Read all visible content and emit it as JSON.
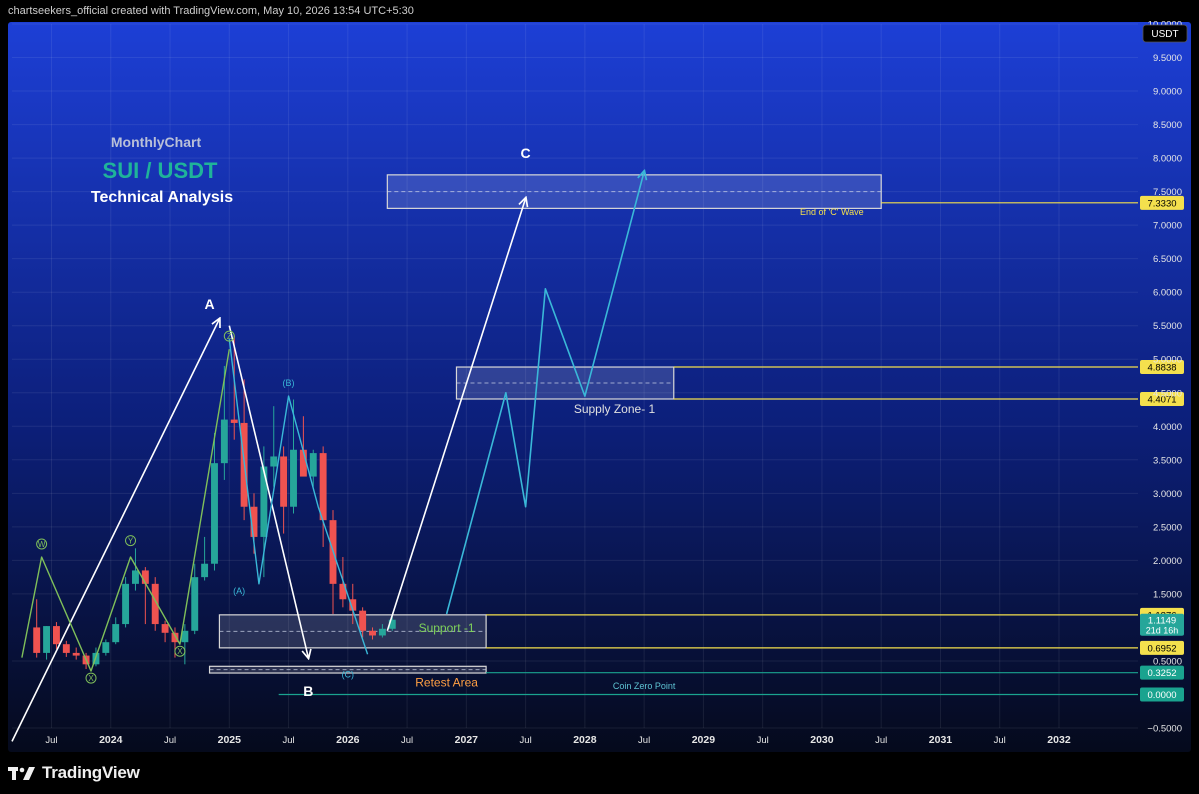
{
  "attribution": "chartseekers_official created with TradingView.com, May 10, 2026 13:54 UTC+5:30",
  "brand": {
    "name": "TradingView"
  },
  "colors": {
    "bg_top": "#1d3fd6",
    "bg_bottom": "#050a1c",
    "up": "#26a69a",
    "down": "#ef5350",
    "wave_white": "#ffffff",
    "wave_cyan": "#3ab8d8",
    "wave_green": "#7fbf5a",
    "level_yellow": "#f4e04d",
    "level_teal": "#1aa38f",
    "retest": "#ff9f43",
    "support_text": "#7fd35a"
  },
  "headings": {
    "monthly": "MonthlyChart",
    "pair": "SUI / USDT",
    "analysis": "Technical Analysis"
  },
  "chart_data": {
    "type": "candlestick",
    "currency_label": "USDT",
    "ylim": [
      -0.5,
      10.0
    ],
    "xlim": [
      "2023-03",
      "2032-09"
    ],
    "y_ticks": [
      -0.5,
      0.5,
      1.5,
      2.0,
      2.5,
      3.0,
      3.5,
      4.0,
      4.5,
      5.0,
      5.5,
      6.0,
      6.5,
      7.0,
      7.5,
      8.0,
      8.5,
      9.0,
      9.5,
      10.0
    ],
    "y_tick_labels": [
      "−0.5000",
      "0.5000",
      "1.5000",
      "2.0000",
      "2.5000",
      "3.0000",
      "3.5000",
      "4.0000",
      "4.5000",
      "5.0000",
      "5.5000",
      "6.0000",
      "6.5000",
      "7.0000",
      "7.5000",
      "8.0000",
      "8.5000",
      "9.0000",
      "9.5000",
      "10.0000"
    ],
    "x_ticks": [
      {
        "date": "2023-07",
        "label": "Jul"
      },
      {
        "date": "2024-01",
        "label": "2024"
      },
      {
        "date": "2024-07",
        "label": "Jul"
      },
      {
        "date": "2025-01",
        "label": "2025"
      },
      {
        "date": "2025-07",
        "label": "Jul"
      },
      {
        "date": "2026-01",
        "label": "2026"
      },
      {
        "date": "2026-07",
        "label": "Jul"
      },
      {
        "date": "2027-01",
        "label": "2027"
      },
      {
        "date": "2027-07",
        "label": "Jul"
      },
      {
        "date": "2028-01",
        "label": "2028"
      },
      {
        "date": "2028-07",
        "label": "Jul"
      },
      {
        "date": "2029-01",
        "label": "2029"
      },
      {
        "date": "2029-07",
        "label": "Jul"
      },
      {
        "date": "2030-01",
        "label": "2030"
      },
      {
        "date": "2030-07",
        "label": "Jul"
      },
      {
        "date": "2031-01",
        "label": "2031"
      },
      {
        "date": "2031-07",
        "label": "Jul"
      },
      {
        "date": "2032-01",
        "label": "2032"
      }
    ],
    "candles": [
      {
        "t": "2023-05",
        "o": 1.0,
        "h": 1.42,
        "l": 0.55,
        "c": 0.62
      },
      {
        "t": "2023-06",
        "o": 0.62,
        "h": 1.02,
        "l": 0.52,
        "c": 1.02
      },
      {
        "t": "2023-07",
        "o": 1.02,
        "h": 1.08,
        "l": 0.68,
        "c": 0.75
      },
      {
        "t": "2023-08",
        "o": 0.75,
        "h": 0.8,
        "l": 0.56,
        "c": 0.62
      },
      {
        "t": "2023-09",
        "o": 0.62,
        "h": 0.7,
        "l": 0.52,
        "c": 0.58
      },
      {
        "t": "2023-10",
        "o": 0.58,
        "h": 0.62,
        "l": 0.38,
        "c": 0.45
      },
      {
        "t": "2023-11",
        "o": 0.45,
        "h": 0.7,
        "l": 0.42,
        "c": 0.62
      },
      {
        "t": "2023-12",
        "o": 0.62,
        "h": 0.82,
        "l": 0.58,
        "c": 0.78
      },
      {
        "t": "2024-01",
        "o": 0.78,
        "h": 1.15,
        "l": 0.75,
        "c": 1.05
      },
      {
        "t": "2024-02",
        "o": 1.05,
        "h": 1.75,
        "l": 1.0,
        "c": 1.65
      },
      {
        "t": "2024-03",
        "o": 1.65,
        "h": 2.18,
        "l": 1.55,
        "c": 1.85
      },
      {
        "t": "2024-04",
        "o": 1.85,
        "h": 1.9,
        "l": 1.05,
        "c": 1.65
      },
      {
        "t": "2024-05",
        "o": 1.65,
        "h": 1.75,
        "l": 0.95,
        "c": 1.05
      },
      {
        "t": "2024-06",
        "o": 1.05,
        "h": 1.1,
        "l": 0.78,
        "c": 0.92
      },
      {
        "t": "2024-07",
        "o": 0.92,
        "h": 1.0,
        "l": 0.55,
        "c": 0.78
      },
      {
        "t": "2024-08",
        "o": 0.78,
        "h": 1.05,
        "l": 0.45,
        "c": 0.95
      },
      {
        "t": "2024-09",
        "o": 0.95,
        "h": 1.95,
        "l": 0.9,
        "c": 1.75
      },
      {
        "t": "2024-10",
        "o": 1.75,
        "h": 2.35,
        "l": 1.7,
        "c": 1.95
      },
      {
        "t": "2024-11",
        "o": 1.95,
        "h": 3.9,
        "l": 1.85,
        "c": 3.45
      },
      {
        "t": "2024-12",
        "o": 3.45,
        "h": 4.9,
        "l": 3.2,
        "c": 4.1
      },
      {
        "t": "2025-01",
        "o": 4.1,
        "h": 5.35,
        "l": 3.8,
        "c": 4.05
      },
      {
        "t": "2025-02",
        "o": 4.05,
        "h": 4.7,
        "l": 2.6,
        "c": 2.8
      },
      {
        "t": "2025-03",
        "o": 2.8,
        "h": 3.0,
        "l": 2.1,
        "c": 2.35
      },
      {
        "t": "2025-04",
        "o": 2.35,
        "h": 3.7,
        "l": 1.75,
        "c": 3.4
      },
      {
        "t": "2025-05",
        "o": 3.4,
        "h": 4.3,
        "l": 3.1,
        "c": 3.55
      },
      {
        "t": "2025-06",
        "o": 3.55,
        "h": 3.7,
        "l": 2.4,
        "c": 2.8
      },
      {
        "t": "2025-07",
        "o": 2.8,
        "h": 4.4,
        "l": 2.7,
        "c": 3.65
      },
      {
        "t": "2025-08",
        "o": 3.65,
        "h": 4.15,
        "l": 3.3,
        "c": 3.25
      },
      {
        "t": "2025-09",
        "o": 3.25,
        "h": 3.65,
        "l": 3.1,
        "c": 3.6
      },
      {
        "t": "2025-10",
        "o": 3.6,
        "h": 3.7,
        "l": 2.2,
        "c": 2.6
      },
      {
        "t": "2025-11",
        "o": 2.6,
        "h": 2.75,
        "l": 1.2,
        "c": 1.65
      },
      {
        "t": "2025-12",
        "o": 1.65,
        "h": 2.05,
        "l": 1.3,
        "c": 1.42
      },
      {
        "t": "2026-01",
        "o": 1.42,
        "h": 1.65,
        "l": 1.05,
        "c": 1.25
      },
      {
        "t": "2026-02",
        "o": 1.25,
        "h": 1.3,
        "l": 0.85,
        "c": 0.95
      },
      {
        "t": "2026-03",
        "o": 0.95,
        "h": 1.0,
        "l": 0.82,
        "c": 0.88
      },
      {
        "t": "2026-04",
        "o": 0.88,
        "h": 1.05,
        "l": 0.85,
        "c": 0.98
      },
      {
        "t": "2026-05",
        "o": 0.98,
        "h": 1.18,
        "l": 0.95,
        "c": 1.1149
      }
    ],
    "waves": [
      {
        "name": "white",
        "color": "#ffffff",
        "width": 1.6,
        "points": [
          [
            "2023-03",
            -0.7
          ],
          [
            "2024-12",
            5.6
          ]
        ]
      },
      {
        "name": "white",
        "color": "#ffffff",
        "width": 1.6,
        "points": [
          [
            "2025-01",
            5.5
          ],
          [
            "2025-09",
            0.55
          ]
        ]
      },
      {
        "name": "white",
        "color": "#ffffff",
        "width": 1.6,
        "points": [
          [
            "2026-05",
            0.95
          ],
          [
            "2027-07",
            7.4
          ]
        ]
      },
      {
        "name": "green",
        "color": "#7fbf5a",
        "width": 1.4,
        "points": [
          [
            "2023-04",
            0.55
          ],
          [
            "2023-06",
            2.05
          ],
          [
            "2023-11",
            0.35
          ],
          [
            "2024-03",
            2.05
          ],
          [
            "2024-08",
            0.75
          ],
          [
            "2025-01",
            5.15
          ]
        ]
      },
      {
        "name": "cyan",
        "color": "#3ab8d8",
        "width": 1.4,
        "points": [
          [
            "2025-01",
            5.3
          ],
          [
            "2025-04",
            1.65
          ],
          [
            "2025-07",
            4.45
          ],
          [
            "2025-10",
            2.8
          ],
          [
            "2026-03",
            0.6
          ]
        ]
      },
      {
        "name": "cyan",
        "color": "#3ab8d8",
        "width": 1.6,
        "points": [
          [
            "2026-11",
            1.2
          ],
          [
            "2027-05",
            4.5
          ],
          [
            "2027-07",
            2.8
          ],
          [
            "2027-09",
            6.05
          ],
          [
            "2028-01",
            4.45
          ],
          [
            "2028-07",
            7.8
          ]
        ]
      }
    ],
    "wave_labels": [
      {
        "text": "A",
        "at": [
          "2024-11",
          5.75
        ],
        "color": "#ffffff",
        "size": 14,
        "bold": true
      },
      {
        "text": "B",
        "at": [
          "2025-09",
          -0.02
        ],
        "color": "#ffffff",
        "size": 14,
        "bold": true
      },
      {
        "text": "C",
        "at": [
          "2027-07",
          8.0
        ],
        "color": "#ffffff",
        "size": 14,
        "bold": true
      },
      {
        "text": "(A)",
        "at": [
          "2025-02",
          1.5
        ],
        "color": "#3ab8d8",
        "size": 9,
        "bold": false
      },
      {
        "text": "(B)",
        "at": [
          "2025-07",
          4.6
        ],
        "color": "#3ab8d8",
        "size": 9,
        "bold": false
      },
      {
        "text": "(C)",
        "at": [
          "2026-01",
          0.25
        ],
        "color": "#3ab8d8",
        "size": 9,
        "bold": false
      },
      {
        "text": "W",
        "at": [
          "2023-06",
          2.2
        ],
        "color": "#7fbf5a",
        "size": 8,
        "circle": true
      },
      {
        "text": "X",
        "at": [
          "2023-11",
          0.2
        ],
        "color": "#7fbf5a",
        "size": 8,
        "circle": true
      },
      {
        "text": "Y",
        "at": [
          "2024-03",
          2.25
        ],
        "color": "#7fbf5a",
        "size": 8,
        "circle": true
      },
      {
        "text": "X",
        "at": [
          "2024-08",
          0.6
        ],
        "color": "#7fbf5a",
        "size": 8,
        "circle": true
      },
      {
        "text": "Z",
        "at": [
          "2025-01",
          5.3
        ],
        "color": "#7fbf5a",
        "size": 8,
        "circle": true
      }
    ],
    "zones": [
      {
        "name": "end-of-c-wave",
        "from": "2026-05",
        "to": "2030-07",
        "low": 7.25,
        "high": 7.75,
        "label": "End of 'C' Wave",
        "label_at": [
          "2030-02",
          7.15
        ],
        "label_color": "#f4e04d",
        "label_size": 9
      },
      {
        "name": "supply-zone-1",
        "from": "2026-12",
        "to": "2028-10",
        "low": 4.4071,
        "high": 4.8838,
        "label": "Supply Zone- 1",
        "label_at": [
          "2028-04",
          4.2
        ],
        "label_color": "#e0e0e0",
        "label_size": 12
      },
      {
        "name": "support-1",
        "from": "2024-12",
        "to": "2027-03",
        "low": 0.6952,
        "high": 1.1876,
        "label": "Support -1",
        "label_at": [
          "2026-11",
          0.93
        ],
        "label_color": "#7fd35a",
        "label_size": 12
      },
      {
        "name": "retest-area",
        "from": "2024-11",
        "to": "2027-03",
        "low": 0.32,
        "high": 0.42,
        "label": "Retest Area",
        "label_at": [
          "2026-11",
          0.12
        ],
        "label_color": "#ff9f43",
        "label_size": 12
      }
    ],
    "levels": [
      {
        "name": "end-c-level",
        "value": 7.333,
        "from": "2030-07",
        "color": "#f4e04d",
        "label": "7.3330",
        "label_bg": "#f4e04d",
        "label_fg": "#000000"
      },
      {
        "name": "supply-high-level",
        "value": 4.8838,
        "from": "2028-10",
        "color": "#f4e04d",
        "label": "4.8838",
        "label_bg": "#f4e04d",
        "label_fg": "#000000"
      },
      {
        "name": "supply-low-level",
        "value": 4.4071,
        "from": "2028-10",
        "color": "#f4e04d",
        "label": "4.4071",
        "label_bg": "#f4e04d",
        "label_fg": "#000000"
      },
      {
        "name": "support-high-level",
        "value": 1.1876,
        "from": "2027-03",
        "color": "#f4e04d",
        "label": "1.1876",
        "label_bg": "#f4e04d",
        "label_fg": "#000000"
      },
      {
        "name": "support-low-level",
        "value": 0.6952,
        "from": "2027-03",
        "color": "#f4e04d",
        "label": "0.6952",
        "label_bg": "#f4e04d",
        "label_fg": "#000000"
      },
      {
        "name": "retest-level",
        "value": 0.3252,
        "from": "2027-03",
        "color": "#1aa38f",
        "label": "0.3252",
        "label_bg": "#1aa38f",
        "label_fg": "#ffffff"
      },
      {
        "name": "zero-level",
        "value": 0.0,
        "from": "2025-06",
        "color": "#1aa38f",
        "label": "0.0000",
        "label_bg": "#1aa38f",
        "label_fg": "#ffffff",
        "note": "Coin Zero Point",
        "note_at": [
          "2028-07",
          0.08
        ]
      }
    ],
    "current_price": {
      "value": 1.1149,
      "label": "1.1149",
      "countdown": "21d 16h",
      "bg": "#26a69a"
    }
  }
}
